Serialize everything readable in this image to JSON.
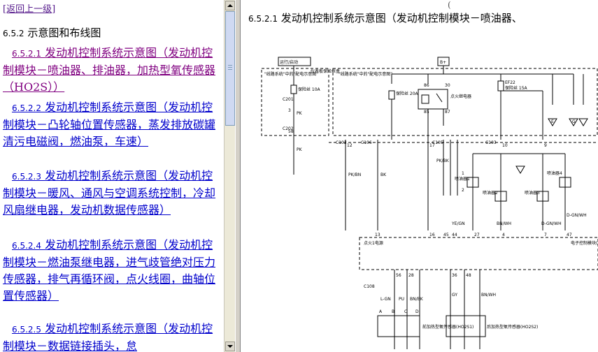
{
  "left_pane": {
    "back_link": "[返回上一级]",
    "section": {
      "number": "6.5.2",
      "title": "示意图和布线图"
    },
    "entries": [
      {
        "number": "6.5.2.1",
        "title": "发动机控制系统示意图（发动机控制模块－喷油器、排油器，加热型氧传感器（HO2S））"
      },
      {
        "number": "6.5.2.2",
        "title": "发动机控制系统示意图（发动机控制模块－凸轮轴位置传感器，蒸发排放碳罐清污电磁阀，燃油泵，车速）"
      },
      {
        "number": "6.5.2.3",
        "title": "发动机控制系统示意图（发动机控制模块－暖风、通风与空调系统控制，冷却风扇继电器，发动机数据传感器）"
      },
      {
        "number": "6.5.2.4",
        "title": "发动机控制系统示意图（发动机控制模块－燃油泵继电器，进气歧管绝对压力传感器，排气再循环阀，点火线圈，曲轴位置传感器）"
      },
      {
        "number": "6.5.2.5",
        "title": "发动机控制系统示意图（发动机控制模块－数据链接插头，怠"
      }
    ]
  },
  "right_pane": {
    "top_stub": "(",
    "heading": {
      "number": "6.5.2.1",
      "title": "发动机控制系统示意图（发动机控制模块－喷油器、"
    }
  },
  "diagram": {
    "labels": {
      "run_crank": "运行/启动",
      "bplus": "B+",
      "fuse_box_note": "\"线路系统\"中的\"配电示意图\"",
      "ip_fuse_block": "仪表板保险丝盒",
      "fuse_10a": "保险丝 10A",
      "power_dist_note": "\"线路系统\"中的\"配电示意图\"",
      "fuse_20a": "保险丝 20A",
      "ign_relay": "点火继电器",
      "ef22": "EF22",
      "fuse_15a": "保险丝 15A",
      "c201": "C201",
      "c202": "C202",
      "c102": "C102",
      "c106": "C106",
      "c103": "C103",
      "c105": "C105",
      "c108": "C108",
      "pk": "PK",
      "pk_bn": "PK/BN",
      "bk": "BK",
      "pk_bk": "PK/BK",
      "ye_gn": "YE/GN",
      "bn_wh": "BN/WH",
      "d_gn_wh": "D-GN/WH",
      "l_gn": "L-GN",
      "pu": "PU",
      "bn_bk": "BN/BK",
      "gy": "GY",
      "injector_1": "喷油器1",
      "injector_2": "喷油器2",
      "injector_3": "喷油器3",
      "injector_4": "喷油器4",
      "ign_power": "点火1电源",
      "ecm": "电子控制模块(ECM)",
      "o2_pre": "前加热型氧传感器(HO2S1)",
      "o2_post": "后加热型氧传感器(HO2S2)",
      "pin_3": "3",
      "pin_4": "4",
      "pin_1": "1",
      "pin_2": "2",
      "pin_13": "13",
      "pin_56": "56",
      "pin_28": "28",
      "pin_36": "36",
      "pin_48": "48",
      "pin_16": "16",
      "pin_45": "45",
      "pin_44": "44",
      "pin_27": "27",
      "pin_7": "7",
      "pin_47": "47",
      "pin_58": "58",
      "pin_12": "12",
      "pin_85": "85",
      "pin_86": "86",
      "pin_87": "87",
      "pin_30": "30",
      "pin_9": "9",
      "pin_10": "10",
      "pin_17": "17",
      "pin_a": "A",
      "pin_b": "B",
      "pin_c": "C",
      "pin_d": "D",
      "pin_e": "E",
      "pin_g": "G"
    }
  }
}
